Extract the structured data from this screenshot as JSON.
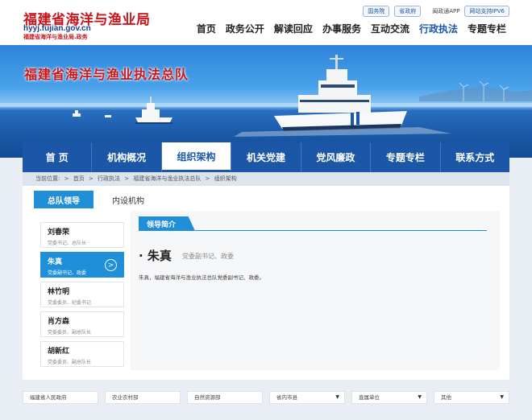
{
  "header": {
    "logo_title": "福建省海洋与渔业局",
    "logo_url": "hyyj.fujian.gov.cn",
    "logo_sub": "福建省海洋与渔业局.政务",
    "top_links": [
      "国务院",
      "省政府"
    ],
    "app_link": "闽政通APP",
    "ipv6": "网站支持IPV6"
  },
  "mainnav": [
    "首页",
    "政务公开",
    "解读回应",
    "办事服务",
    "互动交流",
    "行政执法",
    "专题专栏"
  ],
  "banner": {
    "title": "福建省海洋与渔业执法总队"
  },
  "secnav": [
    "首 页",
    "机构概况",
    "组织架构",
    "机关党建",
    "党风廉政",
    "专题专栏",
    "联系方式"
  ],
  "breadcrumb": [
    "当前位置:",
    "首页",
    "行政执法",
    "福建省海洋与渔业执法总队",
    "组织架构"
  ],
  "tabs": [
    "总队领导",
    "内设机构"
  ],
  "leaders": [
    {
      "name": "刘春荣",
      "title": "党委书记、总队长"
    },
    {
      "name": "朱真",
      "title": "党委副书记、政委"
    },
    {
      "name": "林竹明",
      "title": "党委委员、纪委书记"
    },
    {
      "name": "肖方森",
      "title": "党委委员、副总队长"
    },
    {
      "name": "胡新红",
      "title": "党委委员、副总队长"
    }
  ],
  "detail": {
    "heading": "领导简介",
    "name": "朱真",
    "position": "党委副书记、政委",
    "description": "朱真，福建省海洋与渔业执法总队党委副书记、政委。"
  },
  "footer": {
    "links": [
      "福建省人民政府",
      "农业农村部",
      "自然资源部"
    ],
    "selects": [
      "省内市县",
      "直属单位",
      "其他"
    ]
  },
  "colors": {
    "brand_red": "#c8161d",
    "primary_blue": "#1b57a6",
    "accent_blue": "#1f8fd9"
  }
}
